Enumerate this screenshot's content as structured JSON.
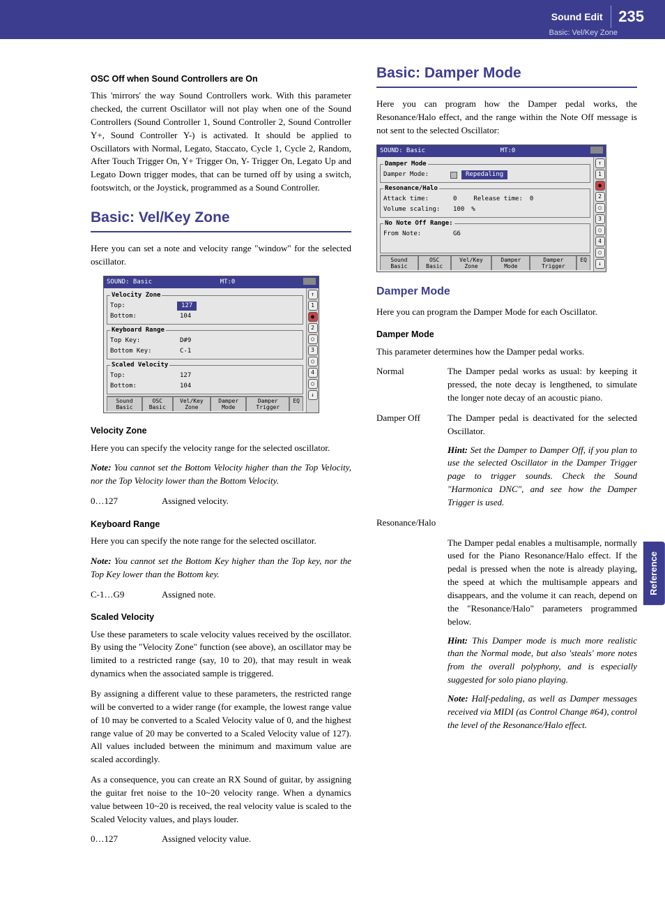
{
  "header": {
    "chapter": "Sound Edit",
    "page_number": "235",
    "subtitle": "Basic: Vel/Key Zone"
  },
  "side_tab": "Reference",
  "left": {
    "h_osc_off": "OSC Off when Sound Controllers are On",
    "p_osc_off": "This 'mirrors' the way Sound Controllers work. With this parameter checked, the current Oscillator will not play when one of the Sound Controllers (Sound Controller 1, Sound Controller 2, Sound Controller Y+, Sound Controller Y-) is activated. It should be applied to Oscillators with Normal, Legato, Staccato, Cycle 1, Cycle 2, Random, After Touch Trigger On, Y+ Trigger On, Y- Trigger On, Legato Up and Legato Down trigger modes, that can be turned off by using a switch, footswitch, or the Joystick, programmed as a Sound Controller.",
    "h_velkey": "Basic: Vel/Key Zone",
    "p_velkey_intro": "Here you can set a note and velocity range \"window\" for the selected oscillator.",
    "shot1": {
      "title_left": "SOUND: Basic",
      "title_right": "MT:0",
      "velocity_zone": {
        "legend": "Velocity Zone",
        "top_lbl": "Top:",
        "top_val": "127",
        "bottom_lbl": "Bottom:",
        "bottom_val": "104"
      },
      "keyboard_range": {
        "legend": "Keyboard Range",
        "topkey_lbl": "Top Key:",
        "topkey_val": "D#9",
        "botkey_lbl": "Bottom Key:",
        "botkey_val": "C-1"
      },
      "scaled_velocity": {
        "legend": "Scaled Velocity",
        "top_lbl": "Top:",
        "top_val": "127",
        "bottom_lbl": "Bottom:",
        "bottom_val": "104"
      },
      "tabs": [
        "Sound\nBasic",
        "OSC\nBasic",
        "Vel/Key\nZone",
        "Damper\nMode",
        "Damper\nTrigger",
        "EQ"
      ],
      "sidebar": [
        "↑",
        "1",
        "●",
        "2",
        "○",
        "3",
        "○",
        "4",
        "○",
        "↓"
      ]
    },
    "h_velzone": "Velocity Zone",
    "p_velzone": "Here you can specify the velocity range for the selected oscillator.",
    "n_velzone": "You cannot set the Bottom Velocity higher than the Top Velocity, nor the Top Velocity lower than the Bottom Velocity.",
    "r_velzone_term": "0…127",
    "r_velzone_def": "Assigned velocity.",
    "h_kbrange": "Keyboard Range",
    "p_kbrange": "Here you can specify the note range for the selected oscillator.",
    "n_kbrange": "You cannot set the Bottom Key higher than the Top key, nor the Top Key lower than the Bottom key.",
    "r_kbrange_term": "C-1…G9",
    "r_kbrange_def": "Assigned note.",
    "h_scaled": "Scaled Velocity",
    "p_scaled1": "Use these parameters to scale velocity values received by the oscillator. By using the \"Velocity Zone\" function (see above), an oscillator may be limited to a restricted range (say, 10 to 20), that may result in weak dynamics when the associated sample is triggered.",
    "p_scaled2": "By assigning a different value to these parameters, the restricted range will be converted to a wider range (for example, the lowest range value of 10 may be converted to a Scaled Velocity value of 0, and the highest range value of 20 may be converted to a Scaled Velocity value of 127). All values included between the minimum and maximum value are scaled accordingly.",
    "p_scaled3": "As a consequence, you can create an RX Sound of guitar, by assigning the guitar fret noise to the 10~20 velocity range. When a dynamics value between 10~20 is received, the real velocity value is scaled to the Scaled Velocity values, and plays louder.",
    "r_scaled_term": "0…127",
    "r_scaled_def": "Assigned velocity value."
  },
  "right": {
    "h_damper": "Basic: Damper Mode",
    "p_damper_intro": "Here you can program how the Damper pedal works, the Resonance/Halo effect, and the range within the Note Off message is not sent to the selected Oscillator:",
    "shot2": {
      "title_left": "SOUND: Basic",
      "title_right": "MT:0",
      "damper_mode": {
        "legend": "Damper Mode",
        "lbl": "Damper Mode:",
        "val": "Repedaling"
      },
      "resonance": {
        "legend": "Resonance/Halo",
        "attack_lbl": "Attack time:",
        "attack_val": "0",
        "release_lbl": "Release time:",
        "release_val": "0",
        "vol_lbl": "Volume scaling:",
        "vol_val": "100",
        "vol_unit": "%"
      },
      "nonote": {
        "legend": "No Note Off Range:",
        "from_lbl": "From Note:",
        "from_val": "G6"
      },
      "tabs": [
        "Sound\nBasic",
        "OSC\nBasic",
        "Vel/Key\nZone",
        "Damper\nMode",
        "Damper\nTrigger",
        "EQ"
      ],
      "sidebar": [
        "↑",
        "1",
        "●",
        "2",
        "○",
        "3",
        "○",
        "4",
        "○",
        "↓"
      ]
    },
    "h_dm_sub": "Damper Mode",
    "p_dm_sub": "Here you can program the Damper Mode for each Oscillator.",
    "h_dm_para": "Damper Mode",
    "p_dm_para": "This parameter determines how the Damper pedal works.",
    "row_normal_term": "Normal",
    "row_normal_def": "The Damper pedal works as usual: by keeping it pressed, the note decay is lengthened, to simulate the longer note decay of an acoustic piano.",
    "row_damperoff_term": "Damper Off",
    "row_damperoff_def": "The Damper pedal is deactivated for the selected Oscillator.",
    "row_damperoff_hint": "Set the Damper to Damper Off, if you plan to use the selected Oscillator in the Damper Trigger page to trigger sounds. Check the Sound \"Harmonica DNC\", and see how the Damper Trigger is used.",
    "row_res_term": "Resonance/Halo",
    "row_res_def": "The Damper pedal enables a multisample, normally used for the Piano Resonance/Halo effect. If the pedal is pressed when the note is already playing, the speed at which the multisample appears and disappears, and the volume it can reach, depend on the \"Resonance/Halo\" parameters programmed below.",
    "row_res_hint": "This Damper mode is much more realistic than the Normal mode, but also 'steals' more notes from the overall polyphony, and is especially suggested for solo piano playing.",
    "row_res_note": "Half-pedaling, as well as Damper messages received via MIDI (as Control Change #64), control the level of the Resonance/Halo effect."
  },
  "labels": {
    "note": "Note:",
    "hint": "Hint:"
  }
}
